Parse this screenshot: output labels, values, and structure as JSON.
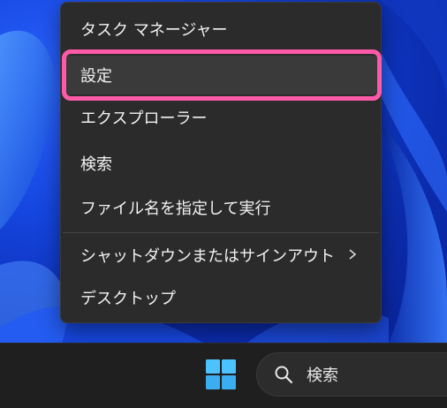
{
  "context_menu": {
    "items": [
      {
        "label": "タスク マネージャー"
      },
      {
        "label": "設定"
      },
      {
        "label": "エクスプローラー"
      },
      {
        "label": "検索"
      },
      {
        "label": "ファイル名を指定して実行"
      },
      {
        "label": "シャットダウンまたはサインアウト",
        "has_submenu": true,
        "submenu_icon": "chevron-right-icon"
      },
      {
        "label": "デスクトップ"
      }
    ],
    "highlighted_item": "設定",
    "highlight_color": "#ff5aa8"
  },
  "taskbar": {
    "start_icon": "windows-logo-icon",
    "search": {
      "icon": "search-icon",
      "label": "検索"
    }
  },
  "colors": {
    "menu_background": "#2b2b2b",
    "taskbar_background": "#1f1f1f",
    "desktop_accent": "#1546e0",
    "windows_logo": "#4cc2ff"
  }
}
